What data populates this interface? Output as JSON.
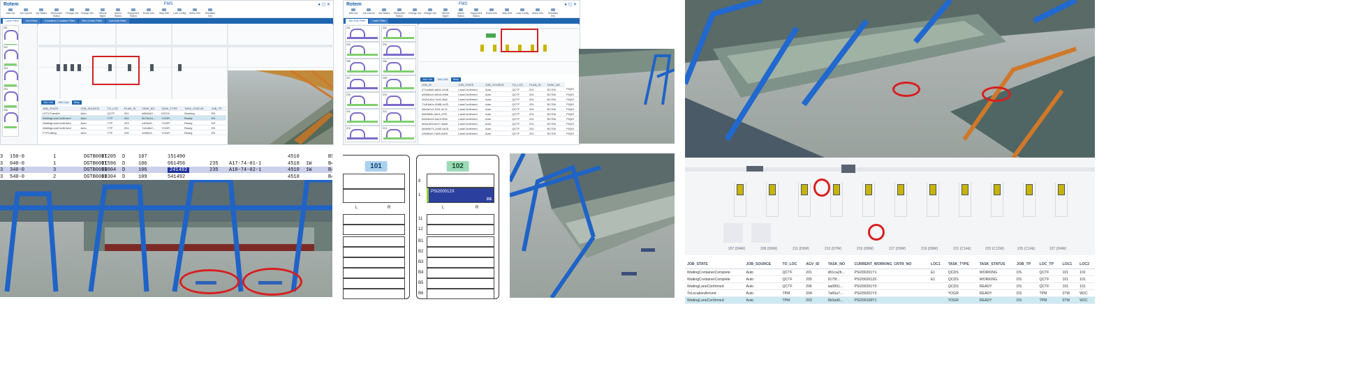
{
  "fms_app": {
    "logo": "Rotem",
    "title": "FMS",
    "toolbar": [
      "Add Job",
      "Job Cancel",
      "Job Status",
      "Workorder Status",
      "Change Job",
      "Charge Veh",
      "Vehicle Mgmt",
      "Admin Status",
      "Equipment Status",
      "Route Info",
      "Map Edit",
      "Lock Config",
      "Alarm Info",
      "Simulator Info"
    ],
    "tabs": [
      "Lane Filter",
      "Veh Filter",
      "Container Location Filter",
      "Sim Crane Filter",
      "Job Edit Filter"
    ]
  },
  "fms_left": {
    "subtabs": [
      "Job List",
      "Veh List",
      "Map"
    ],
    "vehicles": [
      "201",
      "202",
      "203",
      "204",
      "205",
      "206"
    ],
    "table": {
      "headers": [
        "JOB_STATE",
        "JOB_SOURCE",
        "TO_LOC",
        "PLAN_ID",
        "TASK_NO",
        "TASK_TYPE",
        "TASK_STATUS",
        "JOB_TP"
      ],
      "rows": [
        [
          "LFCVTransfer",
          "Auto",
          "QCTF",
          "201",
          "e8b0d42...",
          "DSCH",
          "Working",
          "DS"
        ],
        [
          "WaitingLaneConfirmed",
          "Auto",
          "YTP",
          "202",
          "9b73e1a...",
          "YOGR",
          "Ready",
          "DS"
        ],
        [
          "WaitingLaneConfirmed",
          "Auto",
          "YTP",
          "203",
          "c4f0a19...",
          "YOGR",
          "Ready",
          "DS"
        ],
        [
          "WaitingLaneConfirmed",
          "Auto",
          "YTP",
          "204",
          "7d1e6b2...",
          "YOGR",
          "Ready",
          "DS"
        ],
        [
          "FTPCalling",
          "Auto",
          "YTP",
          "205",
          "2a9f0c3...",
          "YOGR",
          "Ready",
          "DS"
        ]
      ]
    }
  },
  "fms_mid": {
    "subtabs": [
      "Job List",
      "Veh List",
      "Map"
    ],
    "vehicles": [
      "201",
      "202",
      "203",
      "204",
      "205",
      "206",
      "207",
      "208",
      "209",
      "210",
      "211",
      "212",
      "213",
      "214"
    ],
    "table": {
      "headers": [
        "JOB_ID",
        "JOB_STATE",
        "JOB_SOURCE",
        "TO_LOC",
        "PLAN_ID",
        "TASK_NO"
      ],
      "rows": [
        [
          "d71ca5d0-a6d1-41b8",
          "LaneConfirmed",
          "Auto",
          "QCTF",
          "201",
          "B17D6",
          "PIQIO"
        ],
        [
          "a90681c0-b9d3-49b6",
          "LaneConfirmed",
          "Auto",
          "QCTF",
          "201",
          "B17D6",
          "PIQIO"
        ],
        [
          "3c0b1a2d-7ed1-4fa2",
          "LaneConfirmed",
          "Auto",
          "QCTF",
          "201",
          "B17D6",
          "PIQIO"
        ],
        [
          "71d16a1e-0b88-4c33",
          "LaneConfirmed",
          "Auto",
          "QCTF",
          "201",
          "B17D6",
          "PIQIO"
        ],
        [
          "e8c0a7c2-f104-4c7d",
          "LaneConfirmed",
          "Auto",
          "QCTF",
          "201",
          "B17D6",
          "PIQIO"
        ],
        [
          "56fd0b8c-3e21-47f3",
          "LaneConfirmed",
          "Auto",
          "QCTF",
          "201",
          "B17D6",
          "PIQIO"
        ],
        [
          "bd2e6c44-9a19-4f0e",
          "LaneConfirmed",
          "Auto",
          "QCTF",
          "201",
          "B17D6",
          "PIQIO"
        ],
        [
          "0f4a1d93-6c27-4a66",
          "LaneConfirmed",
          "Auto",
          "QCTF",
          "201",
          "B17D6",
          "PIQIO"
        ],
        [
          "9a3e5b71-2d40-4e18",
          "LaneConfirmed",
          "Auto",
          "QCTF",
          "201",
          "B17D6",
          "PIQIO"
        ],
        [
          "c2b8f1e0-7a55-4d09",
          "LaneConfirmed",
          "Auto",
          "QCTF",
          "201",
          "B17D6",
          "PIQIO"
        ]
      ]
    }
  },
  "text_strip": {
    "rows": [
      [
        "3",
        "150-0",
        "1",
        "DGTB0001205",
        "II",
        "D",
        "107",
        "151490",
        "",
        "",
        "4510",
        "",
        "B5"
      ],
      [
        "3",
        "040-0",
        "1",
        "DGTB0001596",
        "II",
        "D",
        "106",
        "061456",
        "235",
        "A17-74-01-1",
        "4510",
        "1W",
        "B4"
      ],
      [
        "3",
        "340-0",
        "3",
        "DGTB0000004",
        "II",
        "D",
        "106",
        "241492",
        "235",
        "A18-74-02-1",
        "4510",
        "1W",
        "B4"
      ],
      [
        "3",
        "540-0",
        "2",
        "DGTB0000304",
        "II",
        "D",
        "109",
        "541492",
        "",
        "",
        "4510",
        "",
        "B4"
      ]
    ]
  },
  "qc_panels": [
    {
      "id": "101",
      "color": "#a9d2ef"
    },
    {
      "id": "102",
      "color": "#9ddbb7",
      "container": "PSI200012X",
      "tag": "DS"
    }
  ],
  "qc_labels": {
    "lr_left": "L",
    "lr_right": "R",
    "row_labels": [
      "8",
      "1",
      "11",
      "12",
      "B1",
      "B2",
      "B3",
      "B4",
      "B5",
      "B6"
    ]
  },
  "job_grid": {
    "headers": [
      "JOB_STATE",
      "JOB_SOURCE",
      "TO_LOC",
      "AGV_ID",
      "TASK_NO",
      "CURRENT_WORKING_CNTR_NO",
      "LOC1",
      "TASK_TYPE",
      "TASK_STATUS",
      "JOB_TP",
      "LOC_TP",
      "LOC1",
      "LOC2"
    ],
    "rows": [
      [
        "WaitingContainerComplete",
        "Auto",
        "QCTF",
        "201",
        "d51ca2b...",
        "PSI200201Y1",
        "E1",
        "QCDS",
        "WORKING",
        "DS",
        "QCTF",
        "101",
        "101"
      ],
      [
        "WaitingContainerComplete",
        "Auto",
        "QCTF",
        "205",
        "9175f...",
        "PSI200201Z6",
        "E1",
        "QCDS",
        "WORKING",
        "DS",
        "QCTF",
        "101",
        "101"
      ],
      [
        "WaitingLaneConfirmed",
        "Auto",
        "QCTF",
        "206",
        "aa0891...",
        "PSI200201Y0",
        "",
        "QCDS",
        "READY",
        "DS",
        "QCTF",
        "101",
        "101"
      ],
      [
        "ToLocationArrived",
        "Auto",
        "TPM",
        "204",
        "7a60a7...",
        "PSI200201Y3",
        "",
        "YOGR",
        "READY",
        "DS",
        "TPM",
        "07W",
        "W2C"
      ],
      [
        "WaitingLaneConfirmed",
        "Auto",
        "TPM",
        "203",
        "0b3ad0...",
        "PSI200108Y1",
        "",
        "YOGR",
        "READY",
        "DS",
        "TPM",
        "07W",
        "W2C"
      ]
    ]
  },
  "zoom_map": {
    "lane_labels": [
      "207 (D4W)",
      "208 (D6W)",
      "211 (D6W)",
      "213 (D7W)",
      "215 (D8W)",
      "217 (D9W)",
      "219 (D8W)",
      "221 (C14E)",
      "223 (C13W)",
      "225 (C14E)",
      "227 (D4W)"
    ]
  }
}
